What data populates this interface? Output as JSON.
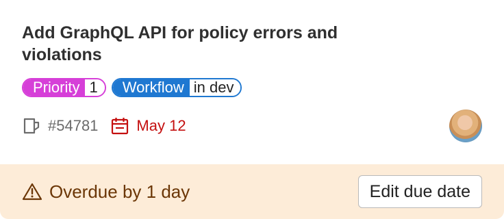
{
  "issue": {
    "title": "Add GraphQL API for policy errors and violations",
    "labels": [
      {
        "key": "Priority",
        "value": "1",
        "color": "#d63fd8"
      },
      {
        "key": "Workflow",
        "value": "in dev",
        "color": "#1f78d1"
      }
    ],
    "reference": "#54781",
    "due_date": "May 12",
    "assignee_avatar_icon": "user-avatar"
  },
  "footer": {
    "warning_text": "Overdue by 1 day",
    "edit_button_label": "Edit due date",
    "background": "#fdecd8"
  },
  "colors": {
    "due_red": "#c40f0f",
    "warning_brown": "#6b3606"
  }
}
